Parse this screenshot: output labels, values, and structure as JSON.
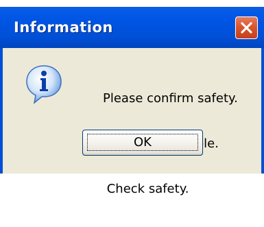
{
  "window": {
    "title": "Information"
  },
  "icons": {
    "message_icon": "info-icon",
    "close_icon": "close-icon"
  },
  "message": {
    "lines": [
      "Please confirm safety.",
      " Parallel IO enable.",
      " Check safety."
    ]
  },
  "buttons": {
    "ok_label": "OK"
  },
  "colors": {
    "titlebar": "#0050d8",
    "close_button": "#d9562f",
    "dialog_background": "#ece9d8"
  }
}
